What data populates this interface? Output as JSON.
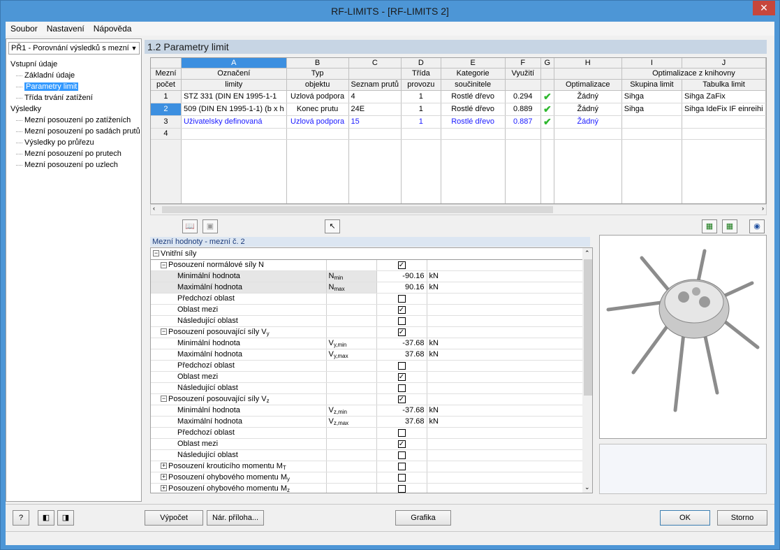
{
  "window": {
    "title": "RF-LIMITS - [RF-LIMITS 2]"
  },
  "menu": [
    "Soubor",
    "Nastavení",
    "Nápověda"
  ],
  "menu_keys": [
    "S",
    "N",
    "N"
  ],
  "left": {
    "combo": "PŘ1 - Porovnání výsledků s mezním",
    "tree": [
      {
        "label": "Vstupní údaje",
        "level": 1
      },
      {
        "label": "Základní údaje",
        "level": 2
      },
      {
        "label": "Parametry limit",
        "level": 2,
        "selected": true
      },
      {
        "label": "Třída trvání zatížení",
        "level": 2
      },
      {
        "label": "Výsledky",
        "level": 1
      },
      {
        "label": "Mezní posouzení po zatíženích",
        "level": 2
      },
      {
        "label": "Mezní posouzení po sadách prutů",
        "level": 2
      },
      {
        "label": "Výsledky po průřezu",
        "level": 2
      },
      {
        "label": "Mezní posouzení po prutech",
        "level": 2
      },
      {
        "label": "Mezní posouzení po uzlech",
        "level": 2
      }
    ]
  },
  "section_title": "1.2 Parametry limit",
  "grid": {
    "col_letters": [
      "A",
      "B",
      "C",
      "D",
      "E",
      "F",
      "G",
      "H",
      "I",
      "J"
    ],
    "rowhdr1": "Mezní",
    "rowhdr2": "počet",
    "h1": [
      "Označení",
      "Typ",
      "",
      "Třída",
      "Kategorie",
      "Využití",
      "",
      "",
      "Optimalizace z knihovny",
      ""
    ],
    "h2": [
      "limity",
      "objektu",
      "Seznam prutů",
      "provozu",
      "součinitele",
      "",
      "",
      "Optimalizace",
      "Skupina limit",
      "Tabulka limit"
    ],
    "rows": [
      {
        "n": "1",
        "a": "STZ 331 (DIN EN 1995-1-1",
        "b": "Uzlová podpora",
        "c": "4",
        "d": "1",
        "e": "Rostlé dřevo",
        "f": "0.294",
        "h": "Žádný",
        "i": "Sihga",
        "j": "Sihga ZaFix"
      },
      {
        "n": "2",
        "a": "509 (DIN EN 1995-1-1) (b x h",
        "b": "Konec prutu",
        "c": "24E",
        "d": "1",
        "e": "Rostlé dřevo",
        "f": "0.889",
        "h": "Žádný",
        "i": "Sihga",
        "j": "Sihga IdeFix IF einreihi"
      },
      {
        "n": "3",
        "a": "Uživatelsky definovaná",
        "b": "Uzlová podpora",
        "c": "15",
        "d": "1",
        "e": "Rostlé dřevo",
        "f": "0.887",
        "h": "Žádný",
        "i": "",
        "j": ""
      },
      {
        "n": "4",
        "a": "",
        "b": "",
        "c": "",
        "d": "",
        "e": "",
        "f": "",
        "h": "",
        "i": "",
        "j": ""
      }
    ]
  },
  "check_glyph": "✔",
  "lower_title": "Mezní hodnoty - mezní č. 2",
  "props": [
    {
      "t": "g0",
      "label": "Vnitřní síly"
    },
    {
      "t": "g1",
      "label": "Posouzení normálové síly N",
      "check": true
    },
    {
      "t": "v",
      "label": "Minimální hodnota",
      "sym": "N",
      "symsub": "min",
      "val": "-90.16",
      "unit": "kN",
      "shade": true
    },
    {
      "t": "v",
      "label": "Maximální hodnota",
      "sym": "N",
      "symsub": "max",
      "val": "90.16",
      "unit": "kN",
      "shade": true
    },
    {
      "t": "c",
      "label": "Předchozí oblast",
      "check": false
    },
    {
      "t": "c",
      "label": "Oblast mezi",
      "check": true
    },
    {
      "t": "c",
      "label": "Následující oblast",
      "check": false
    },
    {
      "t": "g1",
      "label": "Posouzení posouvající síly V",
      "lsub": "y",
      "check": true
    },
    {
      "t": "v",
      "label": "Minimální hodnota",
      "sym": "V",
      "symsub": "y,min",
      "val": "-37.68",
      "unit": "kN"
    },
    {
      "t": "v",
      "label": "Maximální hodnota",
      "sym": "V",
      "symsub": "y,max",
      "val": "37.68",
      "unit": "kN"
    },
    {
      "t": "c",
      "label": "Předchozí oblast",
      "check": false
    },
    {
      "t": "c",
      "label": "Oblast mezi",
      "check": true
    },
    {
      "t": "c",
      "label": "Následující oblast",
      "check": false
    },
    {
      "t": "g1",
      "label": "Posouzení posouvající síly V",
      "lsub": "z",
      "check": true
    },
    {
      "t": "v",
      "label": "Minimální hodnota",
      "sym": "V",
      "symsub": "z,min",
      "val": "-37.68",
      "unit": "kN"
    },
    {
      "t": "v",
      "label": "Maximální hodnota",
      "sym": "V",
      "symsub": "z,max",
      "val": "37.68",
      "unit": "kN"
    },
    {
      "t": "c",
      "label": "Předchozí oblast",
      "check": false
    },
    {
      "t": "c",
      "label": "Oblast mezi",
      "check": true
    },
    {
      "t": "c",
      "label": "Následující oblast",
      "check": false
    },
    {
      "t": "g1c",
      "label": "Posouzení krouticího momentu M",
      "lsub": "T",
      "check": false
    },
    {
      "t": "g1c",
      "label": "Posouzení ohybového momentu M",
      "lsub": "y",
      "check": false
    },
    {
      "t": "g1c",
      "label": "Posouzení ohybového momentu M",
      "lsub": "z",
      "check": false
    }
  ],
  "buttons": {
    "calc": "Výpočet",
    "annex": "Nár. příloha...",
    "graphics": "Grafika",
    "ok": "OK",
    "cancel": "Storno"
  },
  "colors": {
    "accent": "#3c8fe0",
    "check": "#2fb82f",
    "userdef": "#1a1aff"
  }
}
